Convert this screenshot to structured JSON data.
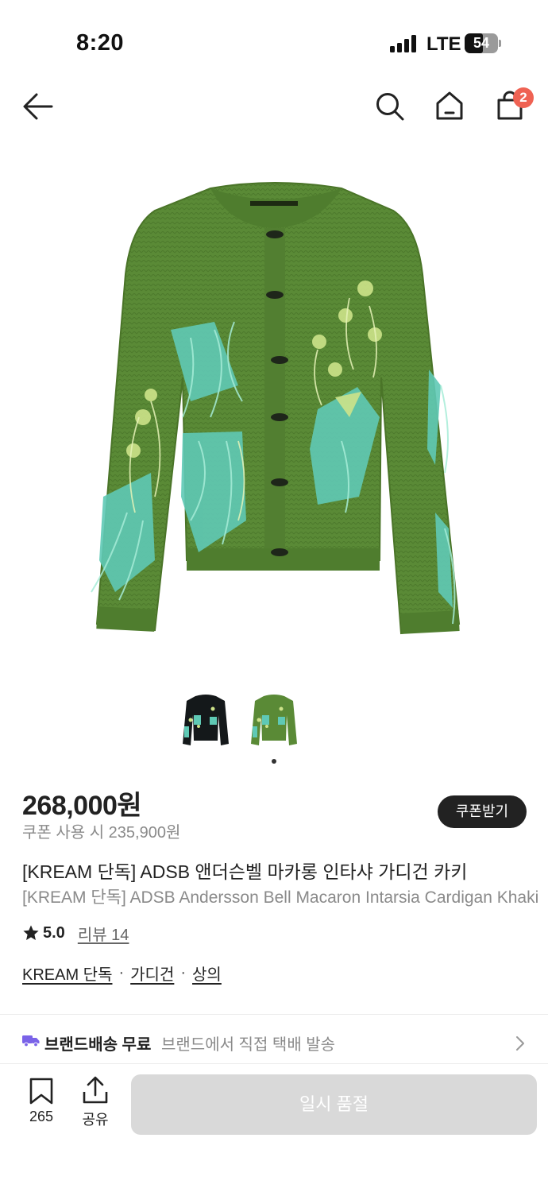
{
  "status": {
    "time": "8:20",
    "network": "LTE",
    "battery": "54",
    "battery_level": 0.54
  },
  "header": {
    "cart_count": "2"
  },
  "product": {
    "price": "268,000원",
    "coupon_price": "쿠폰 사용 시 235,900원",
    "coupon_button": "쿠폰받기",
    "title_ko": "[KREAM 단독] ADSB 앤더슨벨 마카롱 인타샤 가디건 카키",
    "title_en": "[KREAM 단독] ADSB Andersson Bell Macaron Intarsia Cardigan Khaki",
    "rating": "5.0",
    "review_label": "리뷰 14",
    "categories": [
      "KREAM 단독",
      "가디건",
      "상의"
    ],
    "separator": "·",
    "colors": {
      "sweater": "#5a8a36",
      "accent_mint": "#5fc9b5",
      "accent_lime": "#cde38a"
    }
  },
  "shipping": {
    "label": "브랜드배송 무료",
    "desc": "브랜드에서 직접 택배 발송",
    "truck_color": "#7a63e8"
  },
  "bottom_bar": {
    "bookmark_count": "265",
    "share_label": "공유",
    "soldout_label": "일시 품절"
  }
}
